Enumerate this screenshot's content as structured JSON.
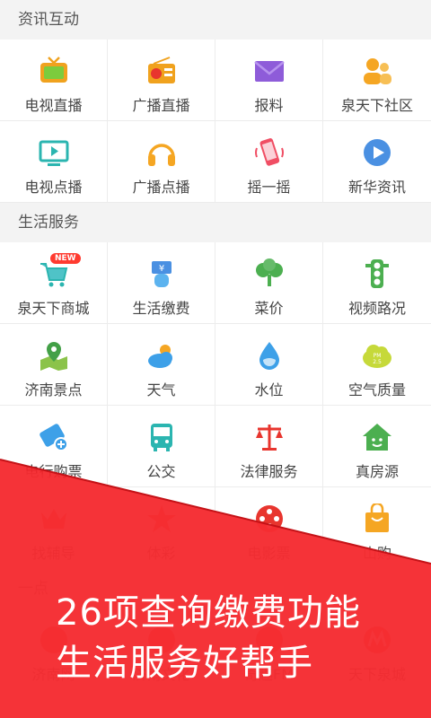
{
  "sections": [
    {
      "title": "资讯互动",
      "items": [
        {
          "label": "电视直播",
          "icon": "tv-icon"
        },
        {
          "label": "广播直播",
          "icon": "radio-icon"
        },
        {
          "label": "报料",
          "icon": "envelope-icon"
        },
        {
          "label": "泉天下社区",
          "icon": "community-icon"
        },
        {
          "label": "电视点播",
          "icon": "tv-play-icon"
        },
        {
          "label": "广播点播",
          "icon": "headphones-icon"
        },
        {
          "label": "摇一摇",
          "icon": "shake-phone-icon"
        },
        {
          "label": "新华资讯",
          "icon": "play-circle-icon"
        }
      ]
    },
    {
      "title": "生活服务",
      "items": [
        {
          "label": "泉天下商城",
          "icon": "shopping-cart-icon",
          "badge": "NEW"
        },
        {
          "label": "生活缴费",
          "icon": "bill-payment-icon"
        },
        {
          "label": "菜价",
          "icon": "vegetable-icon"
        },
        {
          "label": "视频路况",
          "icon": "traffic-light-icon"
        },
        {
          "label": "济南景点",
          "icon": "map-pin-icon"
        },
        {
          "label": "天气",
          "icon": "weather-icon"
        },
        {
          "label": "水位",
          "icon": "water-drop-icon"
        },
        {
          "label": "空气质量",
          "icon": "pm25-cloud-icon"
        },
        {
          "label": "电行购票",
          "icon": "ticket-icon"
        },
        {
          "label": "公交",
          "icon": "bus-icon"
        },
        {
          "label": "法律服务",
          "icon": "scales-icon"
        },
        {
          "label": "真房源",
          "icon": "house-icon"
        },
        {
          "label": "找辅导",
          "icon": "crown-icon"
        },
        {
          "label": "体彩",
          "icon": "lottery-star-icon"
        },
        {
          "label": "电影票",
          "icon": "film-reel-icon"
        },
        {
          "label": "山购",
          "icon": "shopping-bag-icon"
        }
      ]
    },
    {
      "title": "一点",
      "items": [
        {
          "label": "济南网",
          "icon": "jinan-net-icon"
        },
        {
          "label": "济南文化",
          "icon": "culture-icon"
        },
        {
          "label": "奇趣FM",
          "icon": "fm-icon"
        },
        {
          "label": "天下泉城",
          "icon": "tianxia-icon"
        }
      ]
    }
  ],
  "promo": {
    "line1": "26项查询缴费功能",
    "line2": "生活服务好帮手"
  },
  "colors": {
    "banner": "#f42329",
    "accent_orange": "#f5a623",
    "accent_green": "#4caf50",
    "accent_blue": "#3da0e8",
    "accent_red": "#e8352e",
    "accent_purple": "#8e5cd9"
  }
}
